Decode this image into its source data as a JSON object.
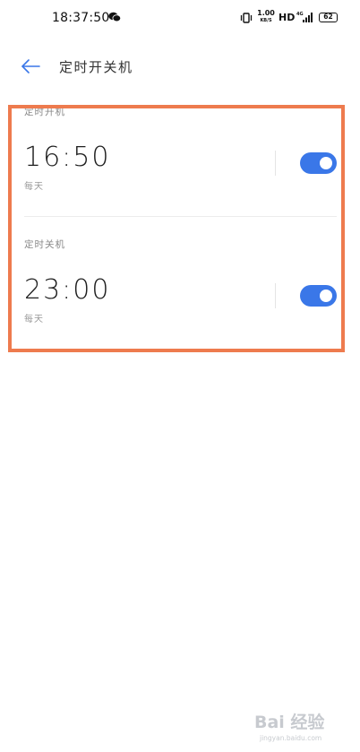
{
  "status_bar": {
    "time": "18:37:50",
    "net_speed_value": "1.00",
    "net_speed_unit": "KB/S",
    "hd": "HD",
    "battery": "62"
  },
  "header": {
    "title": "定时开关机"
  },
  "power_on": {
    "label": "定时开机",
    "time": "16:50",
    "repeat": "每天",
    "enabled": true
  },
  "power_off": {
    "label": "定时关机",
    "time": "23:00",
    "repeat": "每天",
    "enabled": true
  },
  "colors": {
    "accent": "#3a77e8",
    "highlight": "#ee7b4e"
  },
  "watermark": {
    "text": "Bai 经验",
    "sub": "jingyan.baidu.com"
  }
}
